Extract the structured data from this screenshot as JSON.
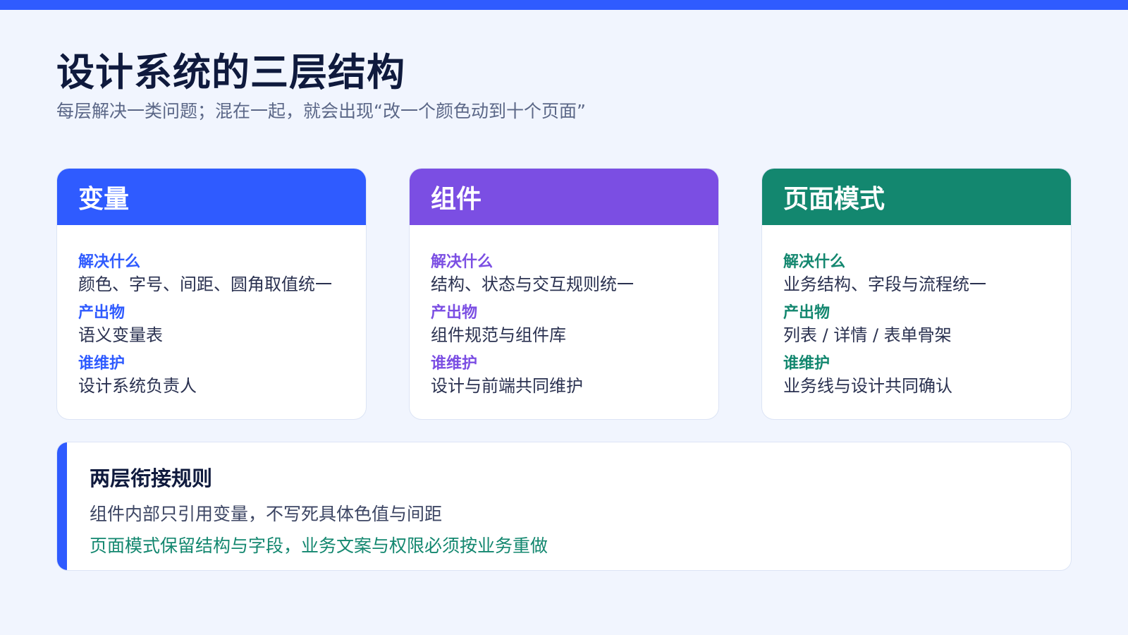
{
  "header": {
    "title": "设计系统的三层结构",
    "subtitle": "每层解决一类问题；混在一起，就会出现“改一个颜色动到十个页面”"
  },
  "colors": {
    "accent_blue": "#2f5bff",
    "accent_purple": "#7b4ee3",
    "accent_green": "#13876f",
    "background": "#f1f5fe"
  },
  "cards": [
    {
      "title": "变量",
      "color": "#2f5bff",
      "label_color": "#2f5bff",
      "what_label": "解决什么",
      "what_value": "颜色、字号、间距、圆角取值统一",
      "output_label": "产出物",
      "output_value": "语义变量表",
      "owner_label": "谁维护",
      "owner_value": "设计系统负责人"
    },
    {
      "title": "组件",
      "color": "#7b4ee3",
      "label_color": "#7b4ee3",
      "what_label": "解决什么",
      "what_value": "结构、状态与交互规则统一",
      "output_label": "产出物",
      "output_value": "组件规范与组件库",
      "owner_label": "谁维护",
      "owner_value": "设计与前端共同维护"
    },
    {
      "title": "页面模式",
      "color": "#13876f",
      "label_color": "#13876f",
      "what_label": "解决什么",
      "what_value": "业务结构、字段与流程统一",
      "output_label": "产出物",
      "output_value": "列表 / 详情 / 表单骨架",
      "owner_label": "谁维护",
      "owner_value": "业务线与设计共同确认"
    }
  ],
  "rules": {
    "title": "两层衔接规则",
    "line1": "组件内部只引用变量，不写死具体色值与间距",
    "line2": "页面模式保留结构与字段，业务文案与权限必须按业务重做"
  }
}
